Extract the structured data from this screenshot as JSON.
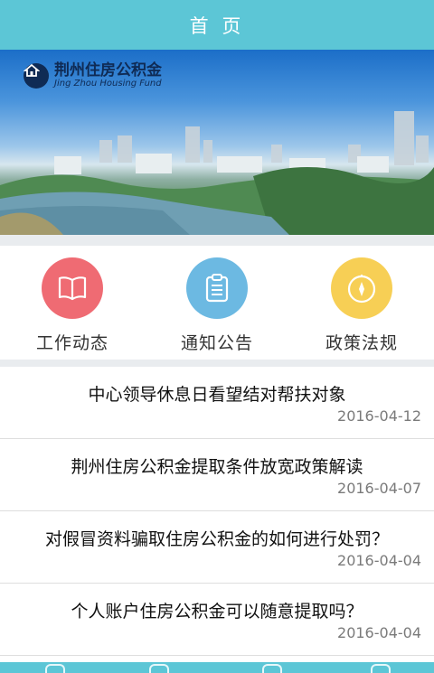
{
  "header": {
    "title": "首 页"
  },
  "banner": {
    "org_name_cn": "荆州住房公积金",
    "org_name_en": "Jing Zhou Housing Fund"
  },
  "quick_links": [
    {
      "label": "工作动态",
      "icon": "book-icon",
      "color": "#ef6b73"
    },
    {
      "label": "通知公告",
      "icon": "clipboard-icon",
      "color": "#6cb9e2"
    },
    {
      "label": "政策法规",
      "icon": "compass-icon",
      "color": "#f7cf55"
    }
  ],
  "news": [
    {
      "title": "中心领导休息日看望结对帮扶对象",
      "date": "2016-04-12"
    },
    {
      "title": "荆州住房公积金提取条件放宽政策解读",
      "date": "2016-04-07"
    },
    {
      "title": "对假冒资料骗取住房公积金的如何进行处罚？",
      "date": "2016-04-04"
    },
    {
      "title": "个人账户住房公积金可以随意提取吗？",
      "date": "2016-04-04"
    }
  ],
  "theme": {
    "accent": "#5cc6d6"
  }
}
